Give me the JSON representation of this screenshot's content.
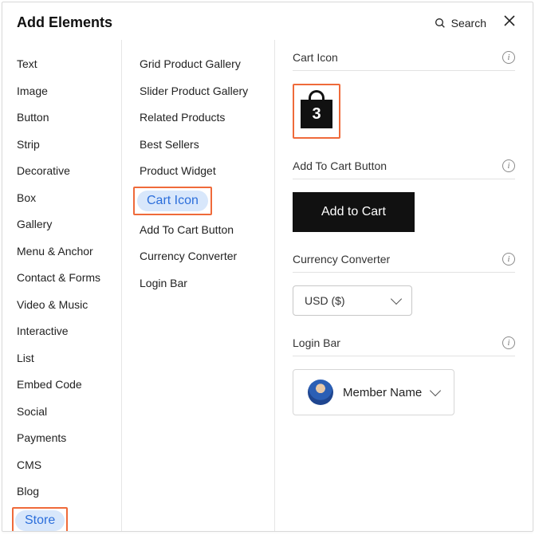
{
  "header": {
    "title": "Add Elements",
    "search_label": "Search"
  },
  "categories": [
    {
      "label": "Text"
    },
    {
      "label": "Image"
    },
    {
      "label": "Button"
    },
    {
      "label": "Strip"
    },
    {
      "label": "Decorative"
    },
    {
      "label": "Box"
    },
    {
      "label": "Gallery"
    },
    {
      "label": "Menu & Anchor"
    },
    {
      "label": "Contact & Forms"
    },
    {
      "label": "Video & Music"
    },
    {
      "label": "Interactive"
    },
    {
      "label": "List"
    },
    {
      "label": "Embed Code"
    },
    {
      "label": "Social"
    },
    {
      "label": "Payments"
    },
    {
      "label": "CMS"
    },
    {
      "label": "Blog"
    },
    {
      "label": "Store",
      "selected": true,
      "highlighted": true
    }
  ],
  "subitems": [
    {
      "label": "Grid Product Gallery"
    },
    {
      "label": "Slider Product Gallery"
    },
    {
      "label": "Related Products"
    },
    {
      "label": "Best Sellers"
    },
    {
      "label": "Product Widget"
    },
    {
      "label": "Cart Icon",
      "selected": true,
      "highlighted": true
    },
    {
      "label": "Add To Cart Button"
    },
    {
      "label": "Currency Converter"
    },
    {
      "label": "Login Bar"
    }
  ],
  "preview": {
    "cart_icon": {
      "title": "Cart Icon",
      "count": "3"
    },
    "add_to_cart": {
      "title": "Add To Cart Button",
      "button_label": "Add to Cart"
    },
    "currency": {
      "title": "Currency Converter",
      "selected": "USD ($)"
    },
    "login": {
      "title": "Login Bar",
      "member_label": "Member Name"
    }
  }
}
